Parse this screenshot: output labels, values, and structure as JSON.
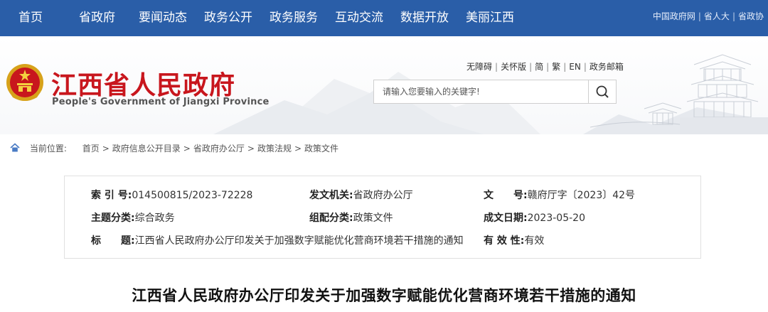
{
  "topnav": {
    "items": [
      "首页",
      "省政府",
      "要闻动态",
      "政务公开",
      "政务服务",
      "互动交流",
      "数据开放",
      "美丽江西"
    ],
    "links": [
      "中国政府网",
      "省人大",
      "省政协"
    ]
  },
  "header": {
    "title": "江西省人民政府",
    "subtitle": "People's Government of Jiangxi Province",
    "util_links": [
      "无障碍",
      "关怀版",
      "简",
      "繁",
      "EN",
      "政务邮箱"
    ],
    "search": {
      "placeholder": "请输入您要输入的关键字!"
    }
  },
  "colors": {
    "nav_bg": "#2a5ea8",
    "title_red": "#c8161d"
  },
  "breadcrumb": {
    "label": "当前位置:",
    "items": [
      "首页",
      "政府信息公开目录",
      "省政府办公厅",
      "政策法规",
      "政策文件"
    ]
  },
  "info": {
    "index_key": "索 引 号:",
    "index_val": "014500815/2023-72228",
    "issuer_key": "发文机关:",
    "issuer_val": "省政府办公厅",
    "docno_key": "文　　号:",
    "docno_val": "赣府厅字〔2023〕42号",
    "topic_key": "主题分类:",
    "topic_val": "综合政务",
    "category_key": "组配分类:",
    "category_val": "政策文件",
    "date_key": "成文日期:",
    "date_val": "2023-05-20",
    "title_key": "标　　题:",
    "title_val": "江西省人民政府办公厅印发关于加强数字赋能优化营商环境若干措施的通知",
    "valid_key": "有 效 性:",
    "valid_val": "有效"
  },
  "article": {
    "title": "江西省人民政府办公厅印发关于加强数字赋能优化营商环境若干措施的通知"
  }
}
